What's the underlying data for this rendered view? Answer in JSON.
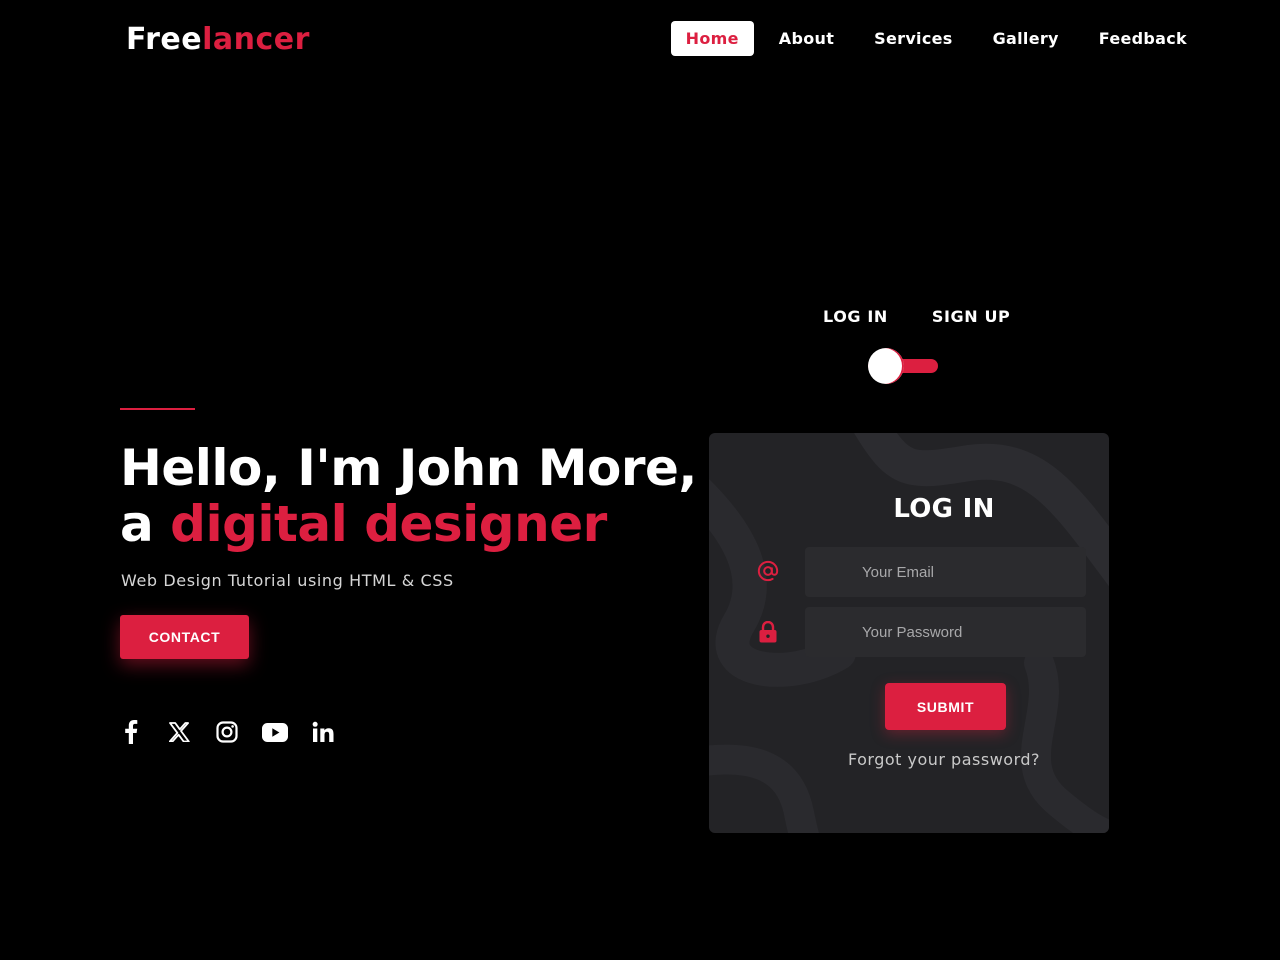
{
  "brand": {
    "logo_part1": "Free",
    "logo_part2": "lancer",
    "accent_color": "#dc1f40"
  },
  "nav": {
    "items": [
      {
        "label": "Home",
        "active": true
      },
      {
        "label": "About"
      },
      {
        "label": "Services"
      },
      {
        "label": "Gallery"
      },
      {
        "label": "Feedback"
      }
    ]
  },
  "hero": {
    "title_line1": "Hello, I'm John More,",
    "title_line2_prefix": "a ",
    "title_line2_accent": "digital designer",
    "subtitle": "Web Design Tutorial using HTML & CSS",
    "contact_label": "CONTACT"
  },
  "socials": [
    "facebook-icon",
    "x-icon",
    "instagram-icon",
    "youtube-icon",
    "linkedin-icon"
  ],
  "auth_switch": {
    "login_label": "LOG IN",
    "signup_label": "SIGN UP",
    "selected": "LOG IN"
  },
  "login_card": {
    "title": "LOG IN",
    "email_placeholder": "Your Email",
    "password_placeholder": "Your Password",
    "submit_label": "SUBMIT",
    "forgot_label": "Forgot your password?"
  }
}
